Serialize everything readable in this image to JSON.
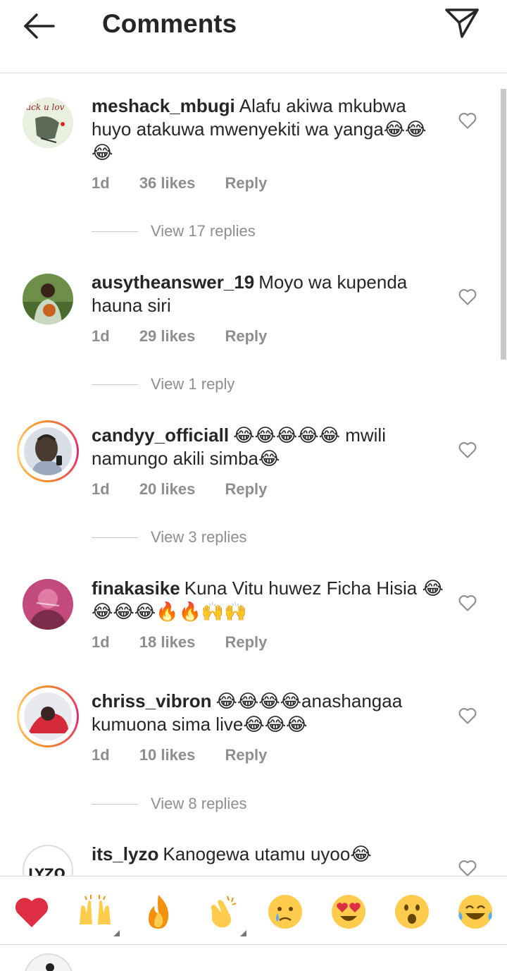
{
  "header": {
    "title": "Comments"
  },
  "comments": [
    {
      "username": "meshack_mbugi",
      "text": "Alafu akiwa mkubwa huyo atakuwa mwenyekiti wa yanga😂😂😂",
      "time": "1d",
      "likes": "36 likes",
      "reply": "Reply",
      "view_replies": "View 17 replies",
      "avatar_text": "ack u lov"
    },
    {
      "username": "ausytheanswer_19",
      "text": "Moyo wa kupenda hauna siri",
      "time": "1d",
      "likes": "29 likes",
      "reply": "Reply",
      "view_replies": "View 1 reply"
    },
    {
      "username": "candyy_officiall",
      "text": "😂😂😂😂😂 mwili namungo akili simba😂",
      "time": "1d",
      "likes": "20 likes",
      "reply": "Reply",
      "view_replies": "View 3 replies"
    },
    {
      "username": "finakasike",
      "text": "Kuna Vitu huwez Ficha Hisia 😂😂😂😂🔥🔥🙌🙌",
      "time": "1d",
      "likes": "18 likes",
      "reply": "Reply"
    },
    {
      "username": "chriss_vibron",
      "text": "😂😂😂😂anashangaa kumuona sima live😂😂😂",
      "time": "1d",
      "likes": "10 likes",
      "reply": "Reply",
      "view_replies": "View 8 replies"
    },
    {
      "username": "its_lyzo",
      "text": "Kanogewa utamu uyoo😂",
      "avatar_text": "LYZO"
    }
  ],
  "quick_reactions": [
    "❤️",
    "🙌",
    "🔥",
    "👏",
    "😢",
    "😍",
    "😮",
    "😂"
  ],
  "colors": {
    "text": "#262626",
    "secondary": "#8e8e8e",
    "heart_red": "#ed4956",
    "divider": "#dbdbdb"
  }
}
